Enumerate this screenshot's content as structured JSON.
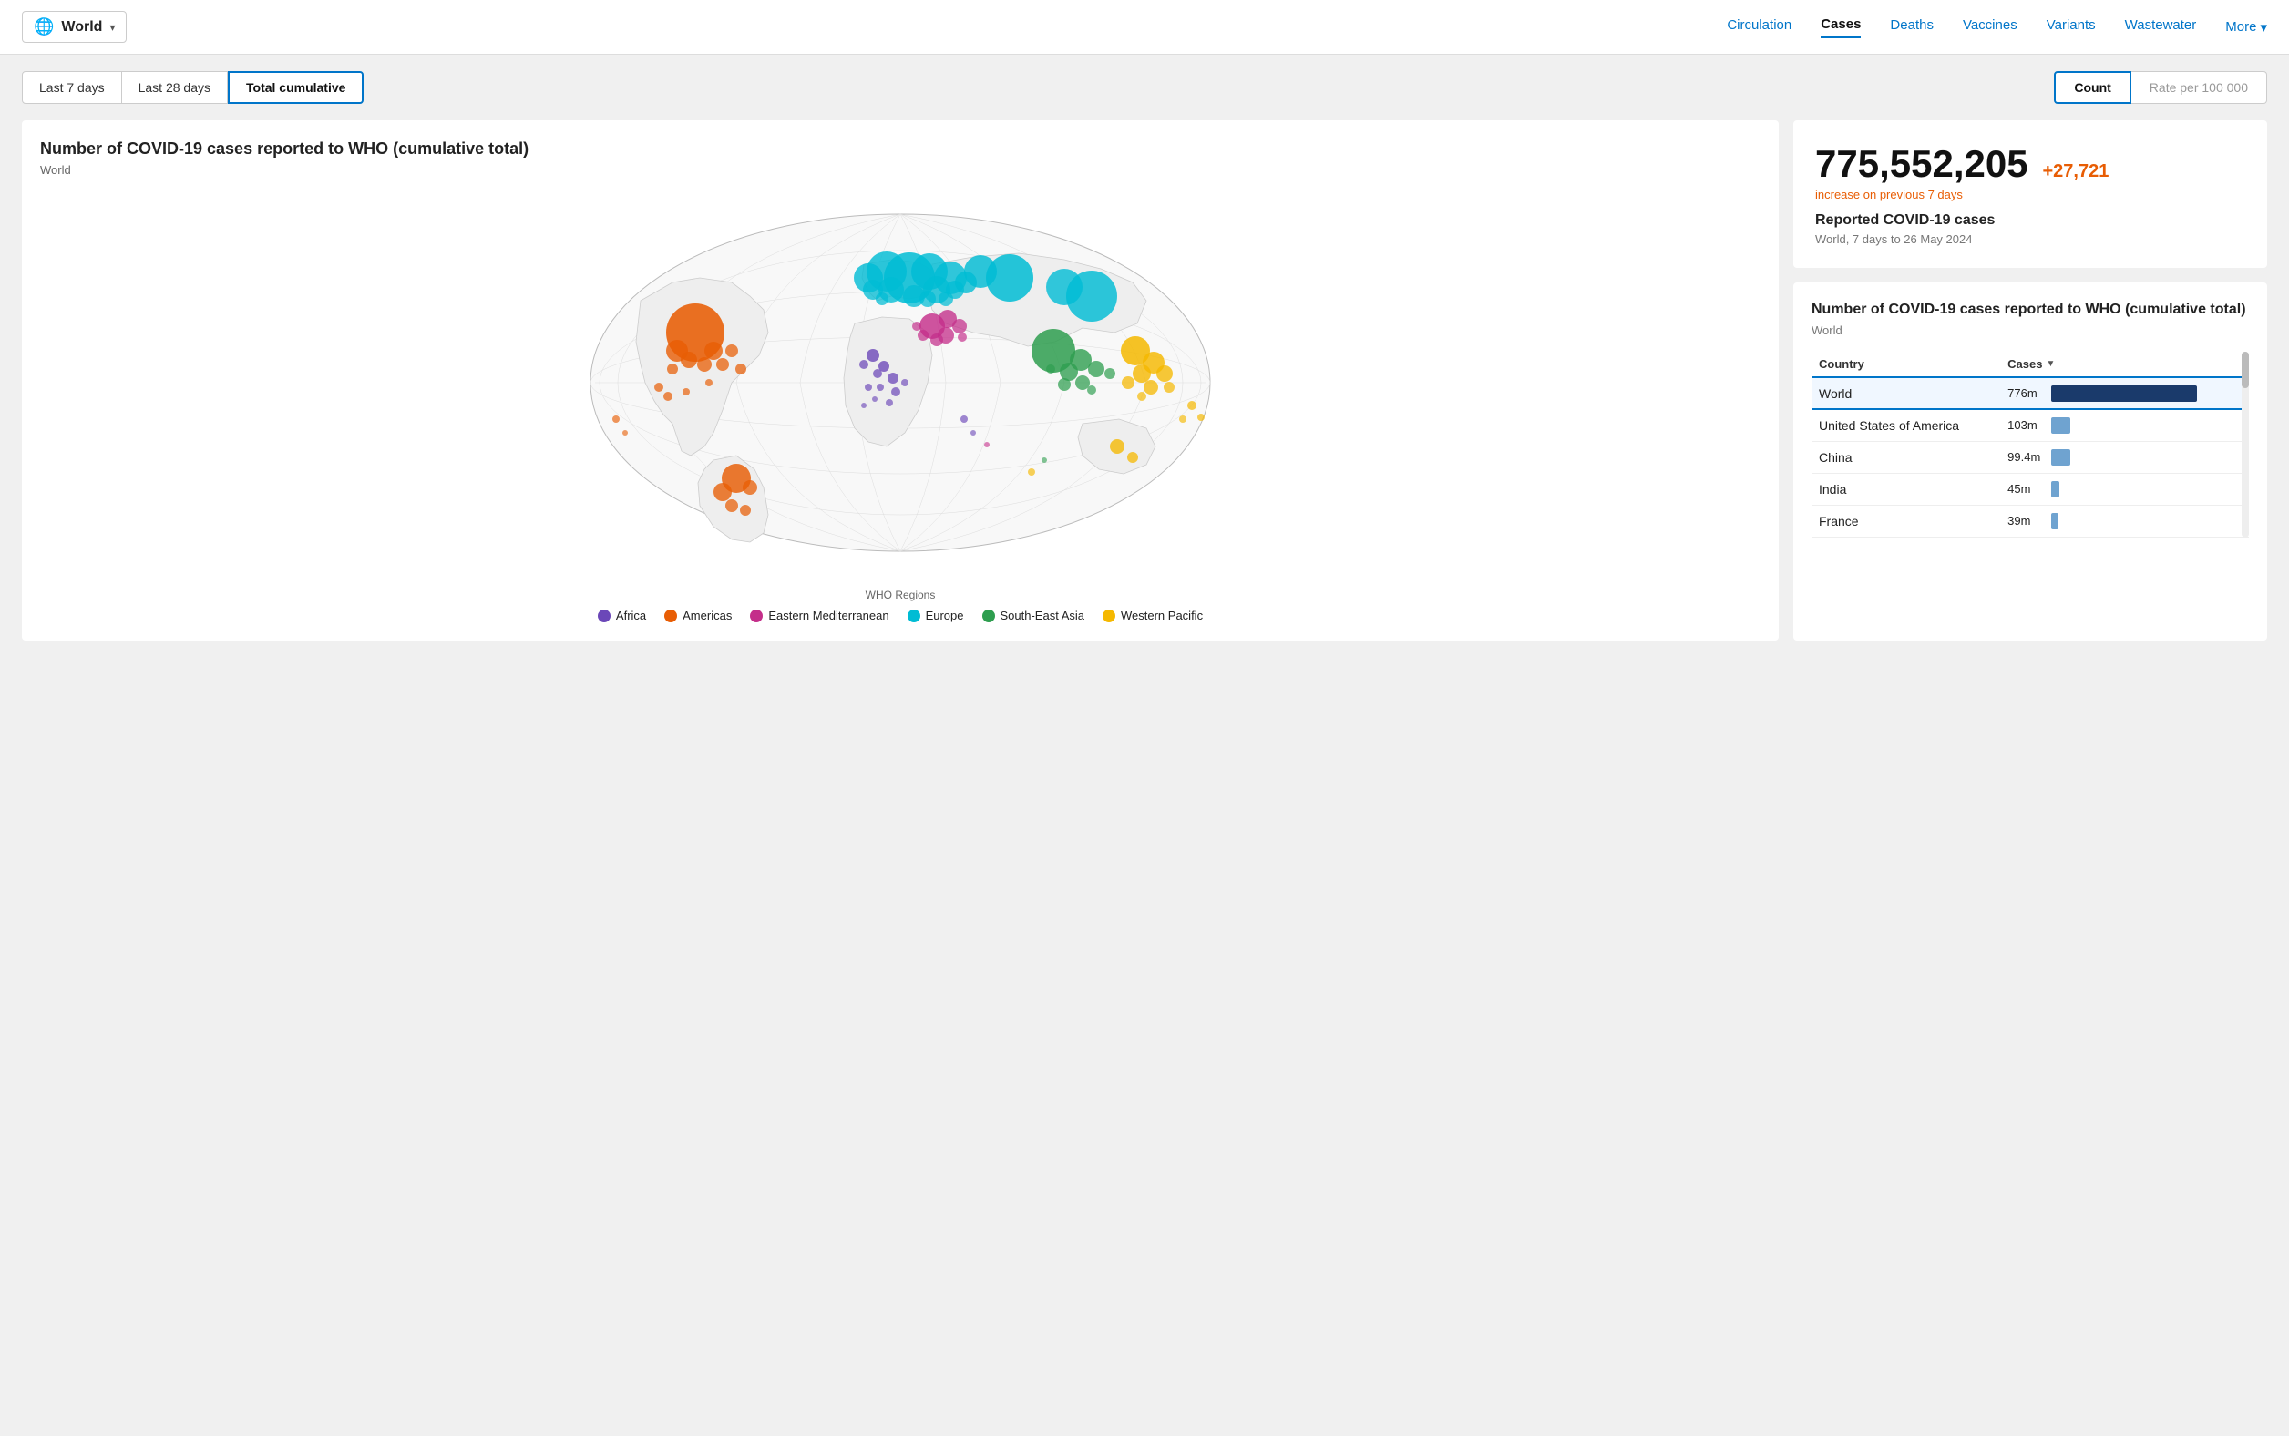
{
  "header": {
    "world_label": "World",
    "nav_items": [
      {
        "id": "circulation",
        "label": "Circulation",
        "active": false
      },
      {
        "id": "cases",
        "label": "Cases",
        "active": true
      },
      {
        "id": "deaths",
        "label": "Deaths",
        "active": false
      },
      {
        "id": "vaccines",
        "label": "Vaccines",
        "active": false
      },
      {
        "id": "variants",
        "label": "Variants",
        "active": false
      },
      {
        "id": "wastewater",
        "label": "Wastewater",
        "active": false
      }
    ],
    "more_label": "More"
  },
  "tabs": {
    "time_options": [
      {
        "id": "last7",
        "label": "Last 7 days",
        "active": false
      },
      {
        "id": "last28",
        "label": "Last 28 days",
        "active": false
      },
      {
        "id": "total",
        "label": "Total cumulative",
        "active": true
      }
    ],
    "toggle_options": [
      {
        "id": "count",
        "label": "Count",
        "active": true
      },
      {
        "id": "rate",
        "label": "Rate per 100 000",
        "active": false
      }
    ]
  },
  "map": {
    "title": "Number of COVID-19 cases reported to WHO (cumulative total)",
    "subtitle": "World",
    "legend_title": "WHO Regions",
    "legend_items": [
      {
        "id": "africa",
        "label": "Africa",
        "color": "#6b47b8"
      },
      {
        "id": "americas",
        "label": "Americas",
        "color": "#e85d04"
      },
      {
        "id": "eastern_med",
        "label": "Eastern Mediterranean",
        "color": "#c42e8a"
      },
      {
        "id": "europe",
        "label": "Europe",
        "color": "#00bcd4"
      },
      {
        "id": "south_east_asia",
        "label": "South-East Asia",
        "color": "#2e9e4f"
      },
      {
        "id": "western_pacific",
        "label": "Western Pacific",
        "color": "#f5b800"
      }
    ]
  },
  "stats": {
    "big_number": "775,552,205",
    "increase": "+27,721",
    "increase_label": "increase on previous 7 days",
    "label": "Reported COVID-19 cases",
    "sub_label": "World, 7 days to 26 May 2024"
  },
  "table": {
    "title": "Number of COVID-19 cases reported to WHO (cumulative total)",
    "subtitle": "World",
    "col_country": "Country",
    "col_cases": "Cases",
    "rows": [
      {
        "country": "World",
        "cases": "776m",
        "bar_pct": 100,
        "bar_color": "#1a3a6b",
        "selected": true
      },
      {
        "country": "United States of America",
        "cases": "103m",
        "bar_pct": 13,
        "bar_color": "#6fa3d0",
        "selected": false
      },
      {
        "country": "China",
        "cases": "99.4m",
        "bar_pct": 12.8,
        "bar_color": "#6fa3d0",
        "selected": false
      },
      {
        "country": "India",
        "cases": "45m",
        "bar_pct": 5.8,
        "bar_color": "#6fa3d0",
        "selected": false
      },
      {
        "country": "France",
        "cases": "39m",
        "bar_pct": 5.0,
        "bar_color": "#6fa3d0",
        "selected": false
      }
    ]
  }
}
